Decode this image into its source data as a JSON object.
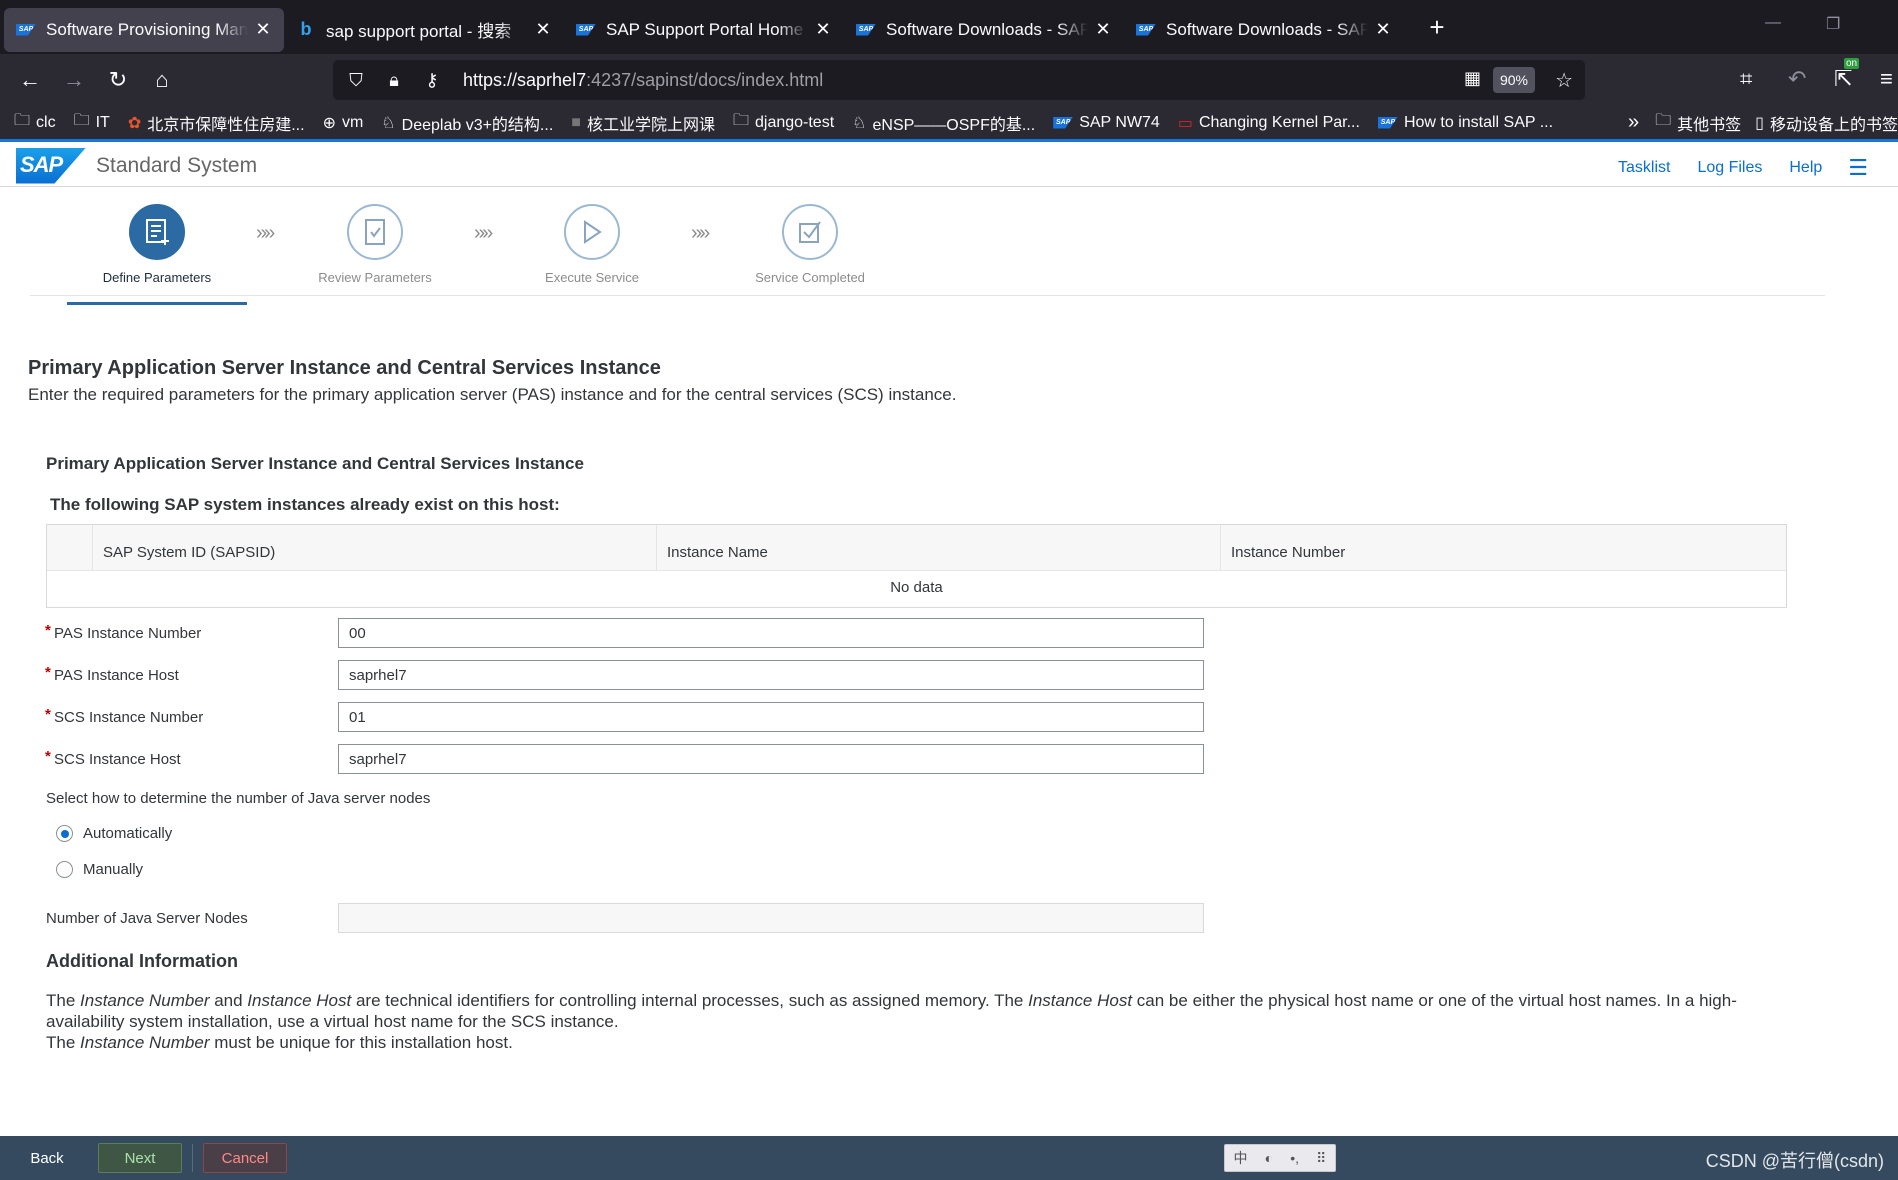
{
  "browser": {
    "tabs": [
      {
        "title": "Software Provisioning Manag",
        "favicon": "sap-favicon",
        "active": true
      },
      {
        "title": "sap support portal - 搜索",
        "favicon": "bing-favicon",
        "active": false
      },
      {
        "title": "SAP Support Portal Home",
        "favicon": "sap-favicon",
        "active": false
      },
      {
        "title": "Software Downloads - SAP O",
        "favicon": "sap-favicon",
        "active": false
      },
      {
        "title": "Software Downloads - SAP O",
        "favicon": "sap-favicon",
        "active": false
      }
    ],
    "url_host": "https://saprhel7",
    "url_rest": ":4237/sapinst/docs/index.html",
    "zoom": "90%",
    "bookmarks": [
      {
        "label": "clc",
        "icon": "folder-icon"
      },
      {
        "label": "IT",
        "icon": "folder-icon"
      },
      {
        "label": "北京市保障性住房建...",
        "icon": "site-icon"
      },
      {
        "label": "vm",
        "icon": "globe-icon"
      },
      {
        "label": "Deeplab v3+的结构...",
        "icon": "site-icon"
      },
      {
        "label": "核工业学院上网课",
        "icon": "site-icon"
      },
      {
        "label": "django-test",
        "icon": "folder-icon"
      },
      {
        "label": "eNSP——OSPF的基...",
        "icon": "site-icon"
      },
      {
        "label": "SAP NW74",
        "icon": "sap-favicon"
      },
      {
        "label": "Changing Kernel Par...",
        "icon": "oracle-icon"
      },
      {
        "label": "How to install SAP ...",
        "icon": "sap-favicon"
      }
    ],
    "bookmarks_right": [
      {
        "label": "其他书签",
        "icon": "folder-icon"
      },
      {
        "label": "移动设备上的书签",
        "icon": "mobile-icon"
      }
    ],
    "extension_badge": "on"
  },
  "shell": {
    "logo": "SAP",
    "title": "Standard System",
    "links": [
      "Tasklist",
      "Log Files",
      "Help"
    ]
  },
  "roadmap": {
    "steps": [
      {
        "label": "Define Parameters",
        "active": true
      },
      {
        "label": "Review Parameters",
        "active": false
      },
      {
        "label": "Execute Service",
        "active": false
      },
      {
        "label": "Service Completed",
        "active": false
      }
    ],
    "separator": "»»"
  },
  "page": {
    "title": "Primary Application Server Instance and Central Services Instance",
    "description": "Enter the required parameters for the primary application server (PAS) instance and for the central services (SCS) instance.",
    "section_title": "Primary Application Server Instance and Central Services Instance",
    "table_title": "The following SAP system instances already exist on this host:",
    "table": {
      "columns": [
        "SAP System ID (SAPSID)",
        "Instance Name",
        "Instance Number"
      ],
      "empty_text": "No data"
    },
    "fields": [
      {
        "label": "PAS Instance Number",
        "value": "00",
        "required": "*"
      },
      {
        "label": "PAS Instance Host",
        "value": "saprhel7",
        "required": "*"
      },
      {
        "label": "SCS Instance Number",
        "value": "01",
        "required": "*"
      },
      {
        "label": "SCS Instance Host",
        "value": "saprhel7",
        "required": "*"
      }
    ],
    "nodes_question": "Select how to determine the number of Java server nodes",
    "radio_options": [
      {
        "label": "Automatically",
        "selected": true
      },
      {
        "label": "Manually",
        "selected": false
      }
    ],
    "nodes_field": {
      "label": "Number of Java Server Nodes",
      "value": ""
    },
    "info_title": "Additional Information",
    "info": {
      "p1_a": "The ",
      "p1_b": "Instance Number",
      "p1_c": " and ",
      "p1_d": "Instance Host",
      "p1_e": " are technical identifiers for controlling internal processes, such as assigned memory. The ",
      "p1_f": "Instance Host",
      "p1_g": " can be either the physical host name or one of the virtual host names. In a high-availability system installation, use a virtual host name for the SCS instance.",
      "p2_a": "The ",
      "p2_b": "Instance Number",
      "p2_c": " must be unique for this installation host."
    }
  },
  "footer": {
    "back": "Back",
    "next": "Next",
    "cancel": "Cancel",
    "watermark": "CSDN @苦行僧(csdn)"
  },
  "colors": {
    "accent": "#0a6ed1",
    "roadmap_active": "#2b6aa2",
    "required": "#bb0000",
    "footer_bg": "#354a5f"
  }
}
